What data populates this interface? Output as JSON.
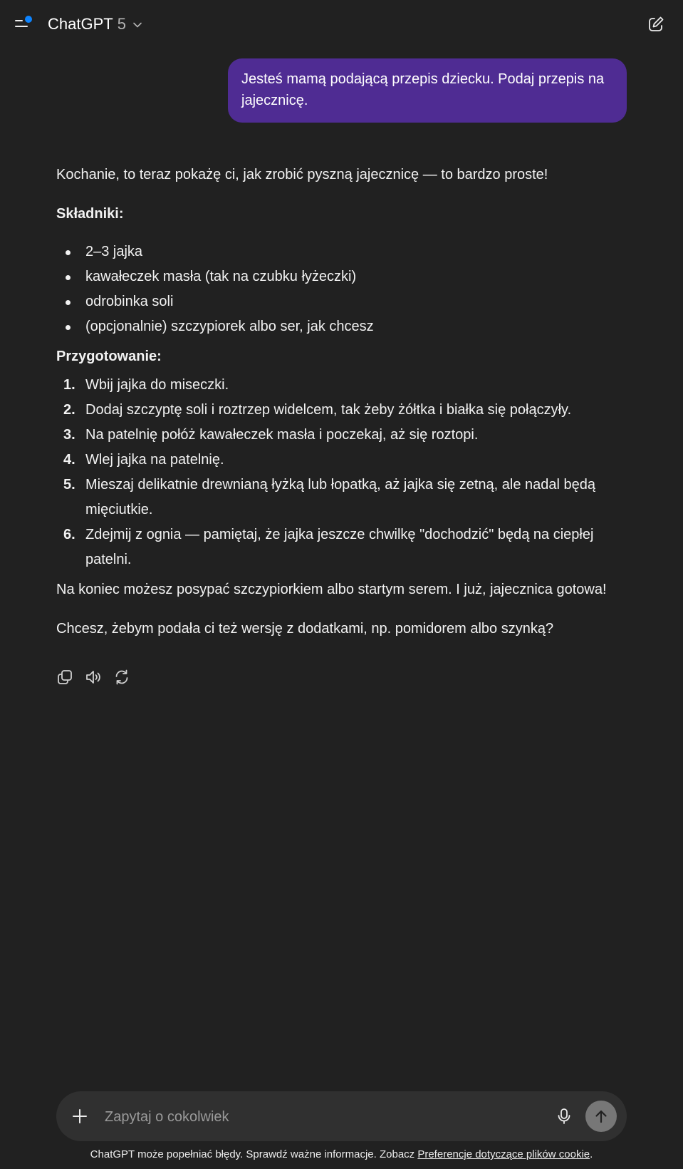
{
  "header": {
    "title": "ChatGPT",
    "model_version": "5",
    "accent_dot_color": "#0d84ff"
  },
  "user_message": {
    "text": "Jesteś mamą podającą przepis dziecku. Podaj przepis na jajecznicę.",
    "bubble_color": "#4f2c93"
  },
  "assistant_message": {
    "intro": "Kochanie, to teraz pokażę ci, jak zrobić pyszną jajecznicę — to bardzo proste!",
    "ingredients_heading": "Składniki:",
    "ingredients": [
      "2–3 jajka",
      "kawałeczek masła (tak na czubku łyżeczki)",
      "odrobinka soli",
      "(opcjonalnie) szczypiorek albo ser, jak chcesz"
    ],
    "preparation_heading": "Przygotowanie:",
    "steps": [
      {
        "num": "1.",
        "text": "Wbij jajka do miseczki."
      },
      {
        "num": "2.",
        "text": "Dodaj szczyptę soli i roztrzep widelcem, tak żeby żółtka i białka się połączyły."
      },
      {
        "num": "3.",
        "text": "Na patelnię połóż kawałeczek masła i poczekaj, aż się roztopi."
      },
      {
        "num": "4.",
        "text": "Wlej jajka na patelnię."
      },
      {
        "num": "5.",
        "text": "Mieszaj delikatnie drewnianą łyżką lub łopatką, aż jajka się zetną, ale nadal będą mięciutkie."
      },
      {
        "num": "6.",
        "text": "Zdejmij z ognia — pamiętaj, że jajka jeszcze chwilkę \"dochodzić\" będą na ciepłej patelni."
      }
    ],
    "closing": "Na koniec możesz posypać szczypiorkiem albo startym serem. I już, jajecznica gotowa!",
    "question": "Chcesz, żebym podała ci też wersję z dodatkami, np. pomidorem albo szynką?",
    "action_icons": [
      "copy-icon",
      "read-aloud-icon",
      "regenerate-icon"
    ]
  },
  "composer": {
    "placeholder": "Zapytaj o cokolwiek",
    "icons": [
      "plus-icon",
      "microphone-icon",
      "arrow-up-icon"
    ]
  },
  "disclaimer": {
    "text": "ChatGPT może popełniać błędy. Sprawdź ważne informacje. Zobacz ",
    "link_text": "Preferencje dotyczące plików cookie",
    "suffix": "."
  }
}
